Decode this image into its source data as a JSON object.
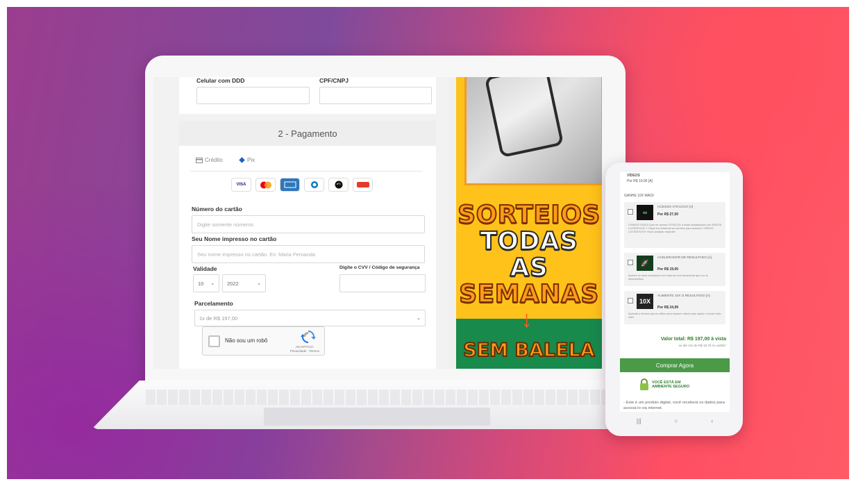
{
  "form": {
    "phone_label": "Celular com DDD",
    "cpf_label": "CPF/CNPJ",
    "section_title": "2 - Pagamento",
    "tabs": [
      {
        "label": "Crédito"
      },
      {
        "label": "Pix"
      }
    ],
    "brands": [
      "VISA",
      "MC",
      "AMEX",
      "DINERS",
      "ELO",
      "HIPER"
    ],
    "card_number_label": "Número do cartão",
    "card_number_placeholder": "Digite somente números",
    "card_name_label": "Seu Nome impresso no cartão",
    "card_name_placeholder": "Seu nome impresso no cartão. Ex: Maria Fernanda",
    "validity_label": "Validade",
    "month": "10",
    "year": "2022",
    "cvv_label": "Digite o CVV / Código de segurança",
    "installments_label": "Parcelamento",
    "installments_value": "1x de R$ 197,00",
    "captcha_text": "Não sou um robô",
    "captcha_brand": "reCAPTCHA",
    "captcha_links": "Privacidade - Termos"
  },
  "banner": {
    "line1": "SORTEIOS",
    "line2": "TODAS",
    "line3": "AS",
    "line4": "SEMANAS",
    "bottom": "SEM BALELA"
  },
  "phone": {
    "top_label": "VÍDEOS",
    "top_price": "Por R$ 19,00 [A]",
    "upsell_title": "GANHE 10X MAIS!",
    "offers": [
      {
        "title": "ACESSO VITALÍCIO [A]",
        "price": "Por R$ 27,00",
        "desc": "CHANCE ÚNICA Quer ter acesso VITALÍCIO a todas atualizações dos VÍDEOS LUCRATIVOS ? Clique em Adicionar ao carrinho para assinar o VÍDEOS LUCRATIVOS+ essa condição especial!",
        "badge": "∞"
      },
      {
        "title": "ACELERADOR DE RESULTADO [A]",
        "price": "Por R$ 19,00",
        "desc": "Acelere os seus resultados com mais de uma ferramenta que vou te disponibilizar",
        "badge": "🚀"
      },
      {
        "title": "AUMENTE 10X O RESULTADO [A]",
        "price": "Por R$ 24,99",
        "desc": "Aprenda a técnica que eu utilizo para separar vídeos mais rápido e lucrar muito mais",
        "badge": "10X"
      }
    ],
    "total": "Valor total: R$ 197,00 à vista",
    "total_sub": "ou até 12x de R$ 19,78 no cartão*",
    "buy_label": "Comprar Agora",
    "secure_line1": "VOCÊ ESTÁ EM",
    "secure_line2": "AMBIENTE SEGURO",
    "bottom_note": "- Este é um produto digital, você receberá os dados para acessá-lo via internet."
  },
  "colors": {
    "accent_green": "#4a9a47",
    "banner_yellow": "#ffc21a"
  }
}
